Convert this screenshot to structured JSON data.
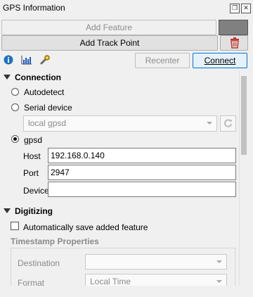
{
  "window": {
    "title": "GPS Information",
    "float_icon": "float-icon",
    "close_icon": "close-icon"
  },
  "toolbar": {
    "add_feature": "Add Feature",
    "add_track_point": "Add Track Point",
    "recenter": "Recenter",
    "connect": "Connect",
    "icons": [
      "info-icon",
      "signal-bars-icon",
      "settings-wrench-icon",
      "trash-icon"
    ],
    "color_swatch": "#808080"
  },
  "connection": {
    "header": "Connection",
    "autodetect": "Autodetect",
    "serial_device": "Serial device",
    "serial_combo_value": "local gpsd",
    "gpsd": "gpsd",
    "host_label": "Host",
    "host_value": "192.168.0.140",
    "port_label": "Port",
    "port_value": "2947",
    "device_label": "Device",
    "device_value": "",
    "selected": "gpsd"
  },
  "digitizing": {
    "header": "Digitizing",
    "auto_save_label": "Automatically save added feature",
    "auto_save_checked": false,
    "timestamp_header": "Timestamp Properties",
    "destination_label": "Destination",
    "destination_value": "",
    "format_label": "Format",
    "format_value": "Local Time"
  },
  "colors": {
    "accent": "#0078d7",
    "delete": "#c0392b",
    "info": "#1e73be"
  }
}
